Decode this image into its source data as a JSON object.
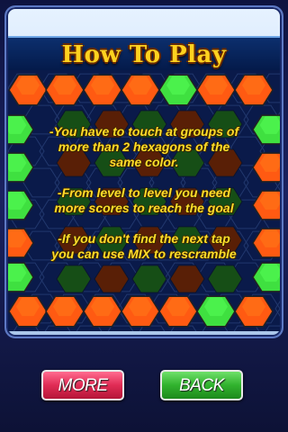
{
  "screen": {
    "title": "How To Play",
    "instructions": [
      {
        "lines": [
          "-You have to touch at groups of",
          "more than 2 hexagons of the",
          "same color."
        ]
      },
      {
        "lines": [
          "-From level to level you need",
          "more scores to reach the goal"
        ]
      },
      {
        "lines": [
          "-If you don't find the next tap",
          "you can use MIX to rescramble"
        ]
      }
    ]
  },
  "buttons": {
    "more_label": "MORE",
    "back_label": "BACK"
  },
  "board": {
    "colors": {
      "orange": "#ff5a12",
      "green": "#3fe040",
      "dark": "#123a22"
    },
    "top_row": [
      "orange",
      "orange",
      "orange",
      "orange",
      "green",
      "orange",
      "orange"
    ],
    "bottom_row": [
      "orange",
      "orange",
      "orange",
      "orange",
      "orange",
      "green",
      "orange"
    ],
    "left_column": [
      "green",
      "green",
      "green",
      "orange",
      "green"
    ],
    "right_column": [
      "green",
      "orange",
      "orange",
      "orange",
      "green"
    ]
  }
}
